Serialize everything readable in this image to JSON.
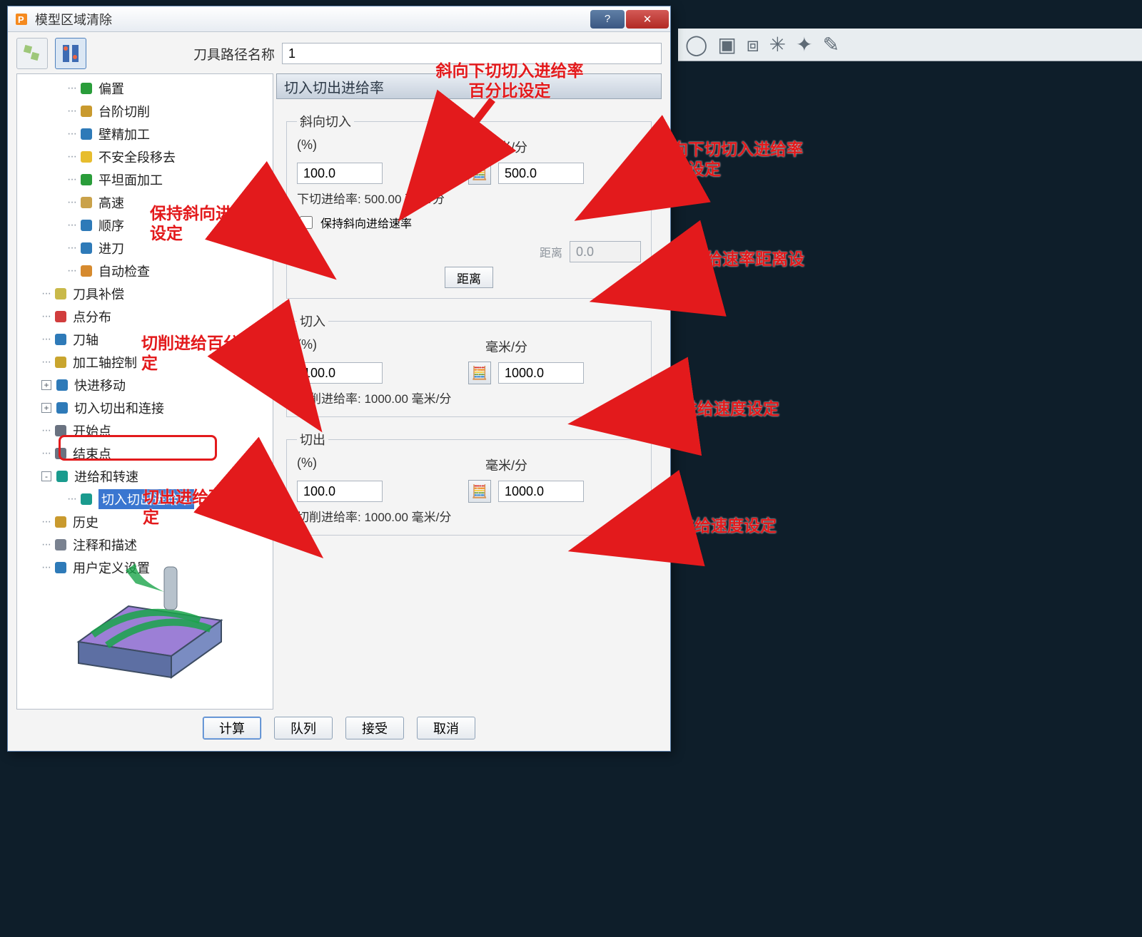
{
  "window": {
    "title": "模型区域清除"
  },
  "toolpath_name": {
    "label": "刀具路径名称",
    "value": "1"
  },
  "panel": {
    "title": "切入切出进给率"
  },
  "tree": {
    "items": [
      {
        "label": "偏置",
        "indent": 68,
        "icon": "green-cap-icon"
      },
      {
        "label": "台阶切削",
        "indent": 68,
        "icon": "stairs-icon"
      },
      {
        "label": "壁精加工",
        "indent": 68,
        "icon": "wall-icon"
      },
      {
        "label": "不安全段移去",
        "indent": 68,
        "icon": "warn-icon"
      },
      {
        "label": "平坦面加工",
        "indent": 68,
        "icon": "flat-icon"
      },
      {
        "label": "高速",
        "indent": 68,
        "icon": "bit-icon"
      },
      {
        "label": "顺序",
        "indent": 68,
        "icon": "hourglass-icon"
      },
      {
        "label": "进刀",
        "indent": 68,
        "icon": "leadin-icon"
      },
      {
        "label": "自动检查",
        "indent": 68,
        "icon": "check-icon"
      },
      {
        "label": "刀具补偿",
        "indent": 32,
        "icon": "comp-icon"
      },
      {
        "label": "点分布",
        "indent": 32,
        "icon": "points-icon"
      },
      {
        "label": "刀轴",
        "indent": 32,
        "icon": "axis-icon"
      },
      {
        "label": "加工轴控制",
        "indent": 32,
        "icon": "ctrl-icon"
      },
      {
        "label": "快进移动",
        "indent": 32,
        "icon": "rapid-icon",
        "expand": "+"
      },
      {
        "label": "切入切出和连接",
        "indent": 32,
        "icon": "link-icon",
        "expand": "+"
      },
      {
        "label": "开始点",
        "indent": 32,
        "icon": "start-icon"
      },
      {
        "label": "结束点",
        "indent": 32,
        "icon": "end-icon"
      },
      {
        "label": "进给和转速",
        "indent": 32,
        "icon": "feed-icon",
        "expand": "-"
      },
      {
        "label": "切入切出进给率",
        "indent": 68,
        "icon": "leadfeed-icon",
        "selected": true
      },
      {
        "label": "历史",
        "indent": 32,
        "icon": "history-icon"
      },
      {
        "label": "注释和描述",
        "indent": 32,
        "icon": "note-icon"
      },
      {
        "label": "用户定义设置",
        "indent": 32,
        "icon": "user-icon"
      }
    ]
  },
  "groups": {
    "ramp": {
      "legend": "斜向切入",
      "pct_label": "(%)",
      "rate_label": "毫米/分",
      "pct_value": "100.0",
      "rate_value": "500.0",
      "sub_text": "下切进给率: 500.00 毫米/分",
      "keep_label": "保持斜向进给速率",
      "dist_label": "距离",
      "dist_value": "0.0",
      "dist_btn": "距离"
    },
    "cutin": {
      "legend": "切入",
      "pct_label": "(%)",
      "rate_label": "毫米/分",
      "pct_value": "100.0",
      "rate_value": "1000.0",
      "sub_text": "切削进给率: 1000.00 毫米/分"
    },
    "cutout": {
      "legend": "切出",
      "pct_label": "(%)",
      "rate_label": "毫米/分",
      "pct_value": "100.0",
      "rate_value": "1000.0",
      "sub_text": "切削进给率: 1000.00 毫米/分"
    }
  },
  "buttons": {
    "calc": "计算",
    "queue": "队列",
    "accept": "接受",
    "cancel": "取消"
  },
  "annotations": {
    "a1": "斜向下切切入进给率百分比设定",
    "a2": "斜向下切切入进给率速度设定",
    "a3": "保持斜向进给速率设定",
    "a4": "斜向进给速率距离设定",
    "a5": "切削进给百分比设定",
    "a6": "切削进给速度设定",
    "a7": "切出进给百分比设定",
    "a8": "切出进给速度设定"
  }
}
